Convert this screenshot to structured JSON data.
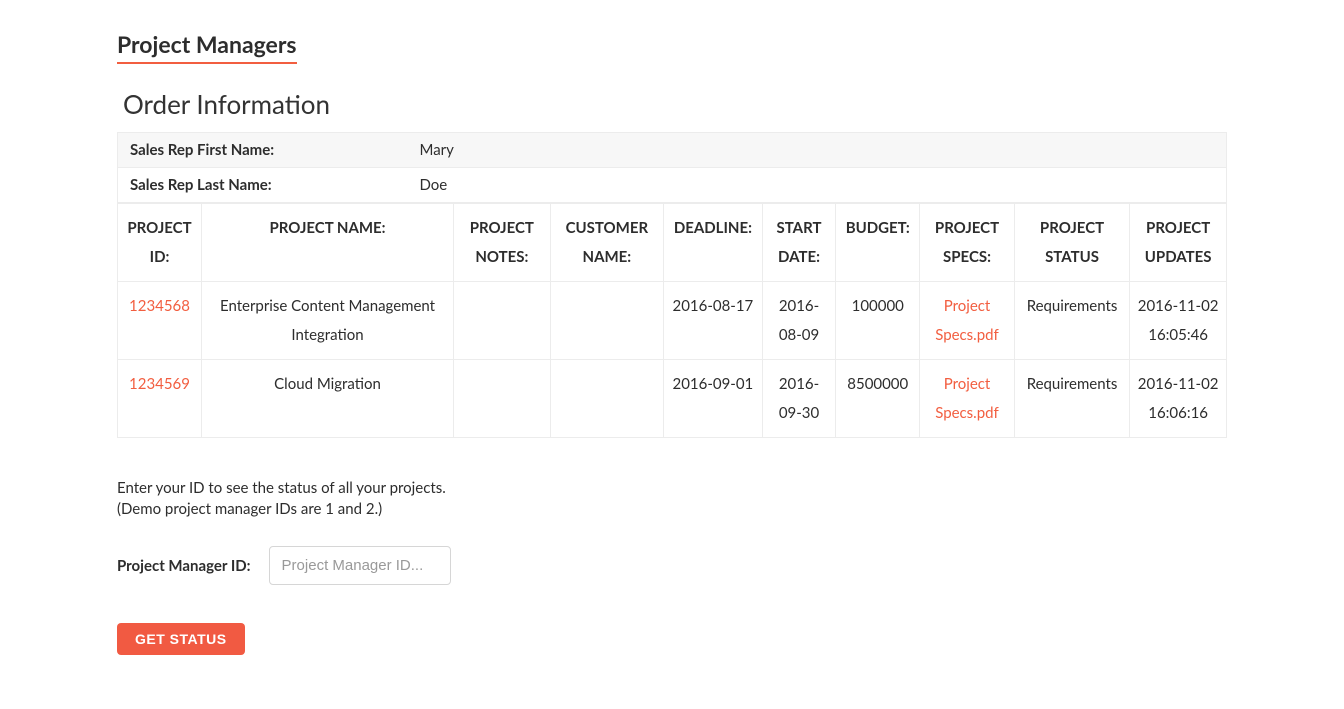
{
  "page": {
    "title": "Project Managers",
    "section_title": "Order Information"
  },
  "sales_rep": {
    "first_name_label": "Sales Rep First Name:",
    "first_name_value": "Mary",
    "last_name_label": "Sales Rep Last Name:",
    "last_name_value": "Doe"
  },
  "columns": {
    "project_id": "PROJECT ID:",
    "project_name": "PROJECT NAME:",
    "project_notes": "PROJECT NOTES:",
    "customer_name": "CUSTOMER NAME:",
    "deadline": "DEADLINE:",
    "start_date": "START DATE:",
    "budget": "BUDGET:",
    "project_specs": "PROJECT SPECS:",
    "project_status": "PROJECT STATUS",
    "project_updates": "PROJECT UPDATES"
  },
  "rows": [
    {
      "project_id": "1234568",
      "project_name": "Enterprise Content Management Integration",
      "project_notes": "",
      "customer_name": "",
      "deadline": "2016-08-17",
      "start_date": "2016-08-09",
      "budget": "100000",
      "project_specs": "Project Specs.pdf",
      "project_status": "Requirements",
      "project_updates": "2016-11-02 16:05:46"
    },
    {
      "project_id": "1234569",
      "project_name": "Cloud Migration",
      "project_notes": "",
      "customer_name": "",
      "deadline": "2016-09-01",
      "start_date": "2016-09-30",
      "budget": "8500000",
      "project_specs": "Project Specs.pdf",
      "project_status": "Requirements",
      "project_updates": "2016-11-02 16:06:16"
    }
  ],
  "instructions": {
    "line1": "Enter your ID to see the status of all your projects.",
    "line2": "(Demo project manager IDs are 1 and 2.)"
  },
  "form": {
    "label": "Project Manager ID:",
    "placeholder": "Project Manager ID...",
    "value": "",
    "button": "GET STATUS"
  }
}
